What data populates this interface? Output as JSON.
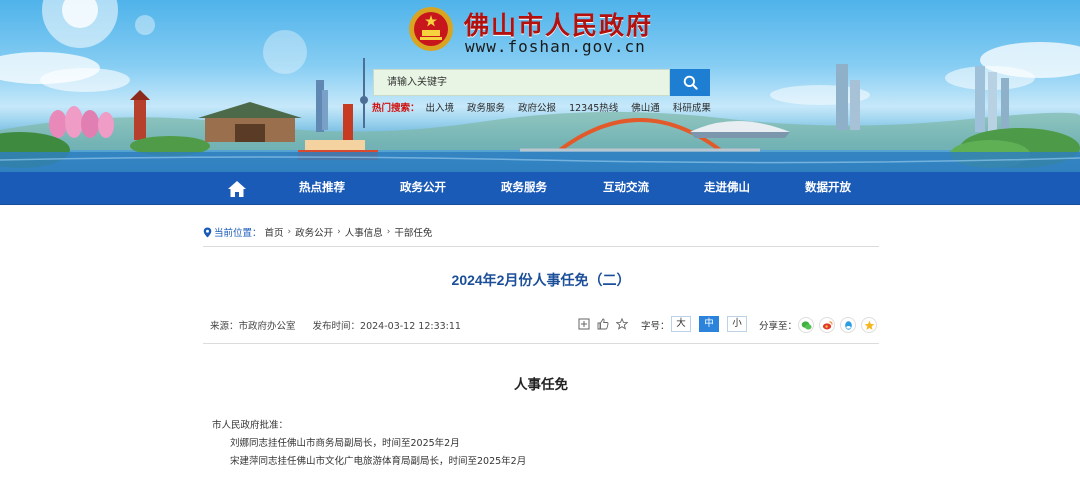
{
  "header": {
    "site_name": "佛山市人民政府",
    "site_url": "www.foshan.gov.cn",
    "emblem_icon": "national-emblem-icon"
  },
  "search": {
    "placeholder": "请输入关键字",
    "hot_label": "热门搜索：",
    "hot_items": [
      "出入境",
      "政务服务",
      "政府公报",
      "12345热线",
      "佛山通",
      "科研成果"
    ]
  },
  "nav": {
    "home_icon": "home-icon",
    "items": [
      "热点推荐",
      "政务公开",
      "政务服务",
      "互动交流",
      "走进佛山",
      "数据开放"
    ]
  },
  "breadcrumb": {
    "label": "当前位置：",
    "items": [
      "首页",
      "政务公开",
      "人事信息",
      "干部任免"
    ]
  },
  "article": {
    "title": "2024年2月份人事任免（二）",
    "source": "来源：市政府办公室",
    "publish_time": "发布时间：2024-03-12 12:33:11",
    "font_size_label": "字号：",
    "font_sizes": [
      "大",
      "中",
      "小"
    ],
    "font_size_selected": "中",
    "share_label": "分享至：",
    "share_targets": [
      "wechat-icon",
      "weibo-icon",
      "qq-icon",
      "qzone-icon"
    ],
    "section_title": "人事任免",
    "paragraphs": [
      "市人民政府批准：",
      "刘娜同志挂任佛山市商务局副局长，时间至2025年2月",
      "宋建萍同志挂任佛山市文化广电旅游体育局副局长，时间至2025年2月"
    ]
  },
  "colors": {
    "nav_bg": "#1b5bb8",
    "title": "#1b4f99",
    "site_name": "#b3100e",
    "hot_label": "#d0100d",
    "search_button": "#1e7fd2"
  }
}
